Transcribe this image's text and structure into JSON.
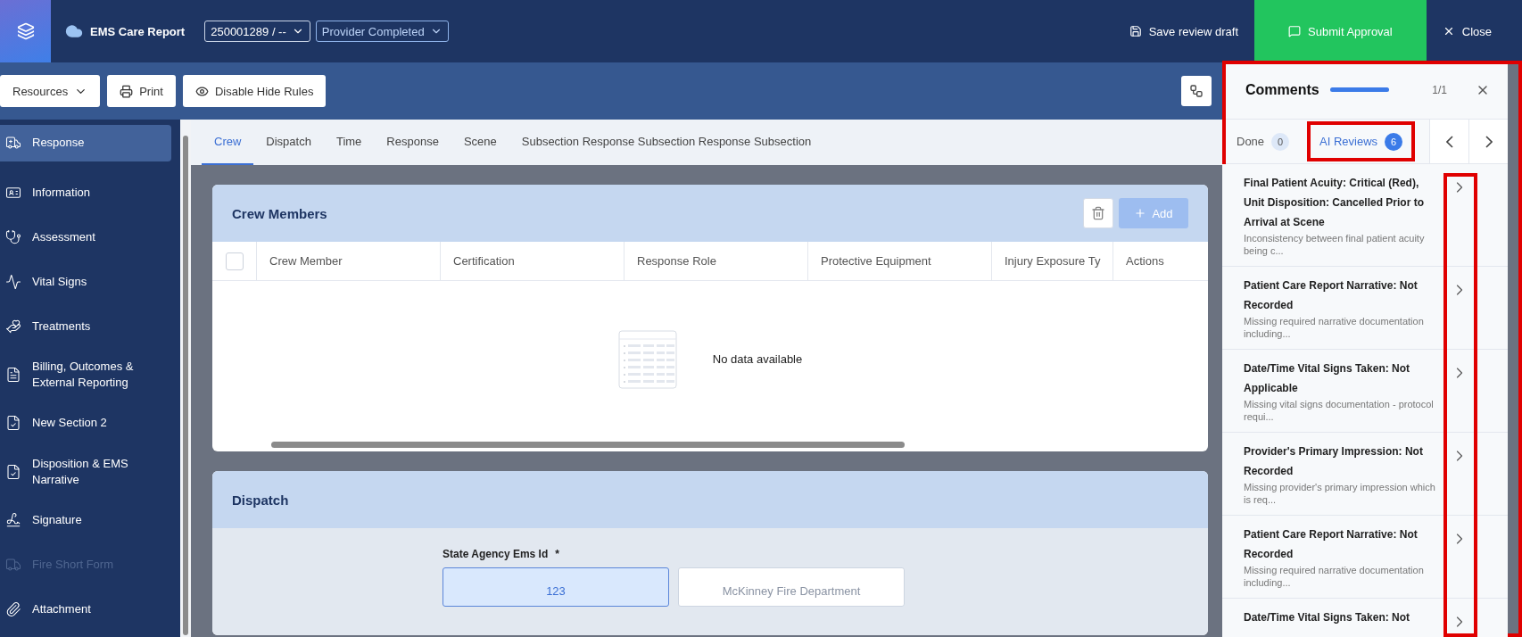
{
  "header": {
    "app_title": "EMS Care Report",
    "record_select": "250001289 / --",
    "status_select": "Provider Completed",
    "actions": [
      {
        "kind": "save",
        "label": "Save review draft"
      },
      {
        "kind": "submit",
        "label": "Submit Approval"
      },
      {
        "kind": "close",
        "label": "Close"
      }
    ]
  },
  "toolbar": {
    "buttons": [
      {
        "kind": "dropdown",
        "label": "Resources"
      },
      {
        "kind": "print",
        "label": "Print"
      },
      {
        "kind": "eye",
        "label": "Disable Hide Rules"
      }
    ]
  },
  "sidebar": {
    "items": [
      {
        "label": "Response",
        "selected": true,
        "disabled": false
      },
      {
        "label": "Information",
        "selected": false,
        "disabled": false
      },
      {
        "label": "Assessment",
        "selected": false,
        "disabled": false
      },
      {
        "label": "Vital Signs",
        "selected": false,
        "disabled": false
      },
      {
        "label": "Treatments",
        "selected": false,
        "disabled": false
      },
      {
        "label": "Billing, Outcomes & External Reporting",
        "selected": false,
        "disabled": false
      },
      {
        "label": "New Section 2",
        "selected": false,
        "disabled": false
      },
      {
        "label": "Disposition & EMS Narrative",
        "selected": false,
        "disabled": false
      },
      {
        "label": "Signature",
        "selected": false,
        "disabled": false
      },
      {
        "label": "Fire Short Form",
        "selected": false,
        "disabled": true
      },
      {
        "label": "Attachment",
        "selected": false,
        "disabled": false
      }
    ]
  },
  "section_tabs": [
    {
      "label": "Crew",
      "selected": true
    },
    {
      "label": "Dispatch",
      "selected": false
    },
    {
      "label": "Time",
      "selected": false
    },
    {
      "label": "Response",
      "selected": false
    },
    {
      "label": "Scene",
      "selected": false
    },
    {
      "label": "Subsection Response Subsection Response Subsection",
      "selected": false
    }
  ],
  "crew_card": {
    "title": "Crew Members",
    "add_label": "Add",
    "add_disabled": true,
    "select_all_checked": false,
    "columns": [
      "Crew Member",
      "Certification",
      "Response Role",
      "Protective Equipment",
      "Injury Exposure Ty",
      "Actions"
    ],
    "empty_text": "No data available"
  },
  "dispatch_card": {
    "title": "Dispatch",
    "field_label": "State Agency Ems Id",
    "required_mark": "*",
    "options": [
      {
        "label": "123",
        "selected": true
      },
      {
        "label": "McKinney Fire Department",
        "selected": false
      }
    ]
  },
  "comments": {
    "title": "Comments",
    "highlighted": true,
    "progress": {
      "level": 1
    },
    "counter": "1/1",
    "tabs": [
      {
        "label": "Done",
        "count": "0",
        "selected": false,
        "highlighted": false
      },
      {
        "label": "AI Reviews",
        "count": "6",
        "selected": true,
        "highlighted": true
      }
    ],
    "chevrons_highlighted": true,
    "items": [
      {
        "title": "Final Patient Acuity: Critical (Red), Unit Disposition: Cancelled Prior to Arrival at Scene",
        "description": "Inconsistency between final patient acuity being c..."
      },
      {
        "title": "Patient Care Report Narrative: Not Recorded",
        "description": "Missing required narrative documentation including..."
      },
      {
        "title": "Date/Time Vital Signs Taken: Not Applicable",
        "description": "Missing vital signs documentation - protocol requi..."
      },
      {
        "title": "Provider's Primary Impression: Not Recorded",
        "description": "Missing provider's primary impression which is req..."
      },
      {
        "title": "Patient Care Report Narrative: Not Recorded",
        "description": "Missing required narrative documentation including..."
      },
      {
        "title": "Date/Time Vital Signs Taken: Not"
      }
    ]
  }
}
